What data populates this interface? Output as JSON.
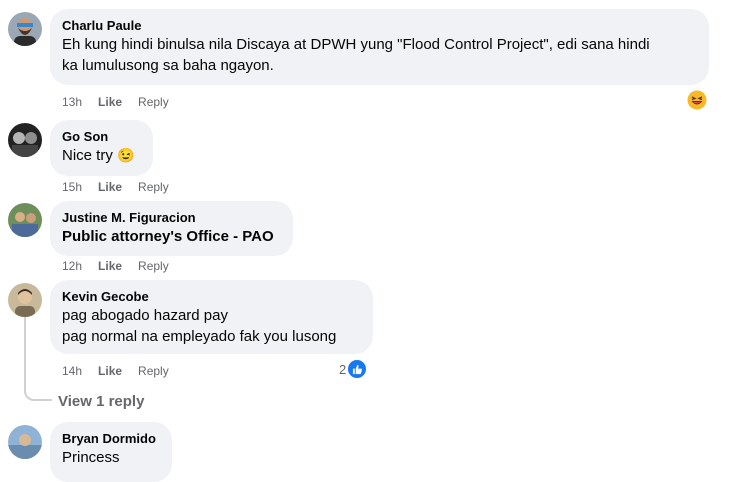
{
  "comments": [
    {
      "author": "Charlu Paule",
      "text": "Eh kung hindi binulsa nila Discaya at DPWH yung \"Flood Control Project\", edi sana hindi\nka lumulusong sa baha ngayon.",
      "time": "13h",
      "like": "Like",
      "reply": "Reply",
      "reaction_icon": "laughing-emoji"
    },
    {
      "author": "Go Son",
      "text": "Nice try",
      "emoji": "😉",
      "time": "15h",
      "like": "Like",
      "reply": "Reply"
    },
    {
      "author": "Justine M. Figuracion",
      "text": "Public attorney's Office - PAO",
      "time": "12h",
      "like": "Like",
      "reply": "Reply"
    },
    {
      "author": "Kevin Gecobe",
      "text": "pag abogado hazard pay\npag normal na empleyado fak you lusong",
      "time": "14h",
      "like": "Like",
      "reply": "Reply",
      "reaction_count": "2",
      "reaction_icon": "thumbs-up"
    },
    {
      "author": "Bryan Dormido",
      "text": "Princess"
    }
  ],
  "view_replies": "View 1 reply",
  "colors": {
    "bubble_bg": "#f0f2f5",
    "meta_text": "#65676b",
    "like_blue": "#1877f2"
  }
}
